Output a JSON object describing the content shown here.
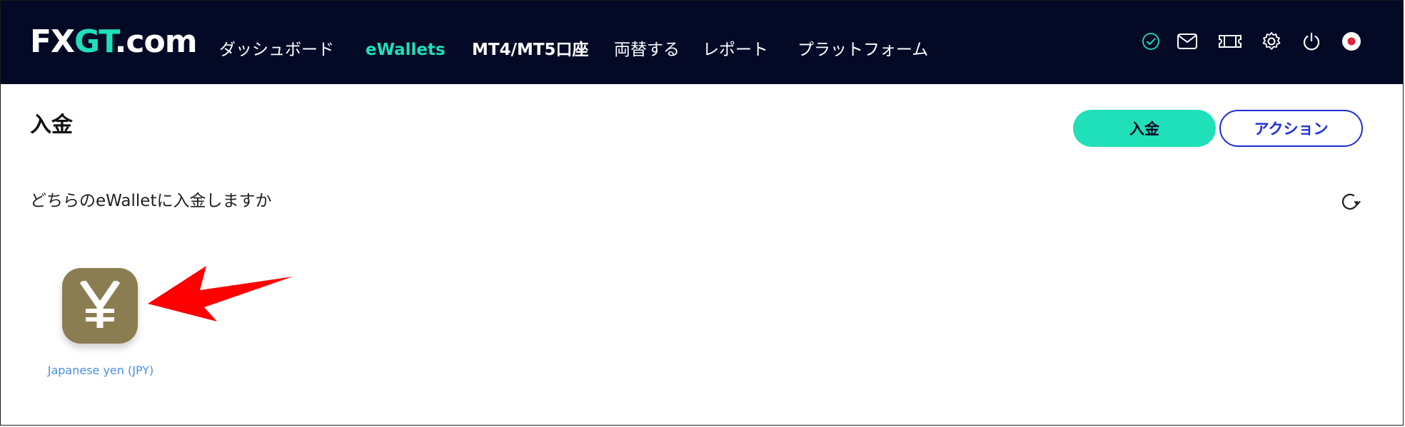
{
  "header": {
    "logo": {
      "fx": "FX",
      "gt": "GT",
      "com": ".com"
    },
    "nav": [
      {
        "label": "ダッシュボード"
      },
      {
        "label": "eWallets"
      },
      {
        "label": "MT4/MT5口座"
      },
      {
        "label": "両替する"
      },
      {
        "label": "レポート"
      },
      {
        "label": "プラットフォーム"
      }
    ],
    "icons": [
      "verified-check-icon",
      "mail-icon",
      "ticket-icon",
      "gear-icon",
      "power-icon",
      "japan-flag-icon"
    ]
  },
  "page": {
    "title": "入金",
    "deposit_button": "入金",
    "action_button": "アクション",
    "question": "どちらのeWalletに入金しますか"
  },
  "wallets": [
    {
      "symbol": "¥",
      "label": "Japanese yen (JPY)"
    }
  ],
  "colors": {
    "header_bg": "#040a26",
    "accent": "#1fe0b8",
    "action_blue": "#1d2fd6",
    "wallet_icon_bg": "#8b7d52",
    "wallet_label": "#4a90e2",
    "annotation_arrow": "#ff0000"
  }
}
